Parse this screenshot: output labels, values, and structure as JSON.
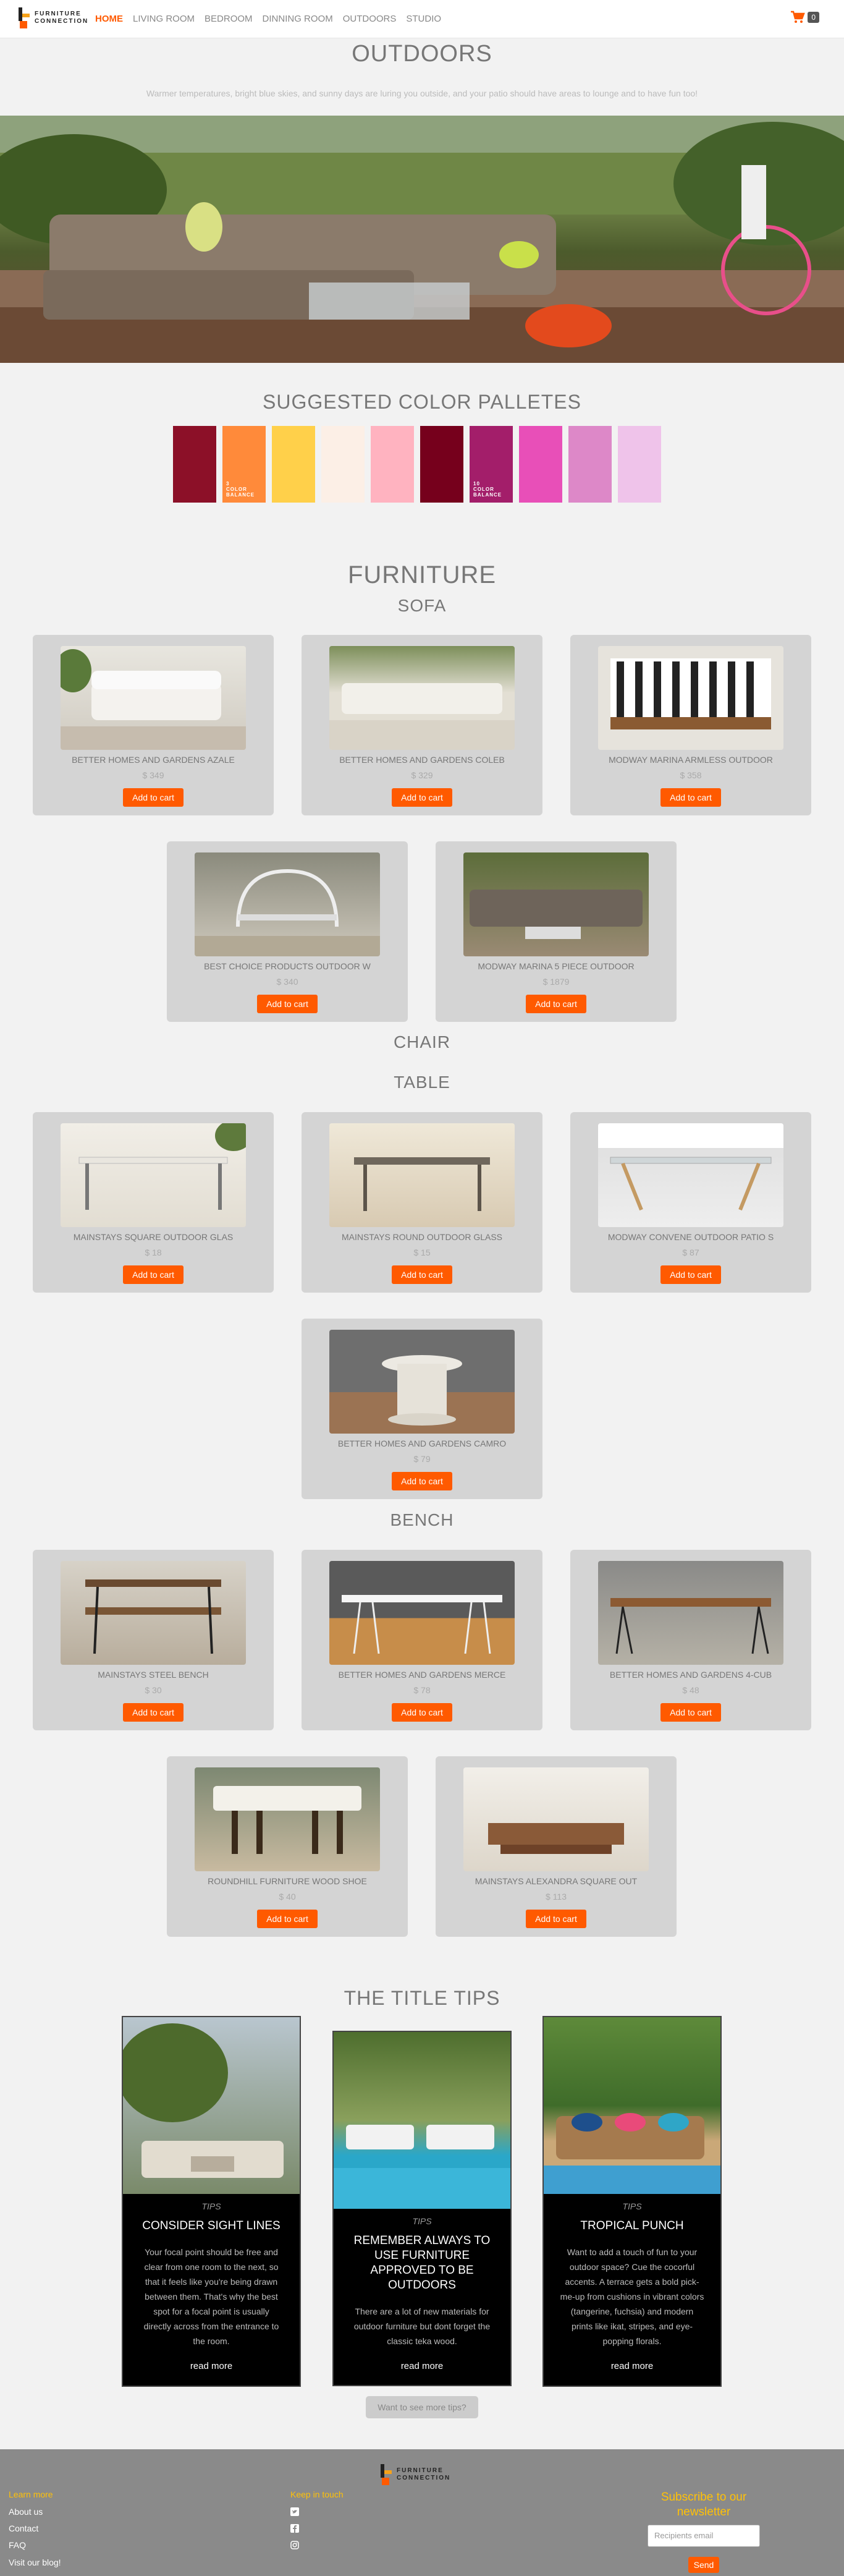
{
  "nav": {
    "logo_line1": "FURNITURE",
    "logo_line2": "CONNECTION",
    "links": [
      "HOME",
      "LIVING ROOM",
      "BEDROOM",
      "DINNING ROOM",
      "OUTDOORS",
      "STUDIO"
    ],
    "active": "HOME",
    "cart_count": "0",
    "cart_icon": "shopping-cart-icon"
  },
  "header": {
    "title": "OUTDOORS",
    "subtitle": "Warmer temperatures, bright blue skies, and sunny days are luring you outside, and your patio should have areas to lounge and to have fun too!"
  },
  "palettes": {
    "title": "SUGGESTED COLOR PALLETES",
    "swatches": [
      {
        "color": "#8c1028",
        "label": ""
      },
      {
        "color": "#ff8a3a",
        "label": ""
      },
      {
        "color": "#ffd04a",
        "label": ""
      },
      {
        "color": "#fcefe6",
        "label": ""
      },
      {
        "color": "#ffb3c0",
        "label": ""
      },
      {
        "color": "#76001c",
        "label": ""
      },
      {
        "color": "#a31e6a",
        "label": ""
      },
      {
        "color": "#e84fb8",
        "label": ""
      },
      {
        "color": "#dd88c8",
        "label": ""
      },
      {
        "color": "#efc3ea",
        "label": ""
      }
    ],
    "swatch_caption_a": "3\nCOLOR\nBALANCE",
    "swatch_caption_b": "10\nCOLOR\nBALANCE"
  },
  "furniture": {
    "title": "FURNITURE",
    "sofa_title": "SOFA",
    "chair_title": "CHAIR",
    "table_title": "TABLE",
    "bench_title": "BENCH",
    "add_to_cart": "Add to cart",
    "sofa": [
      {
        "name": "BETTER HOMES AND GARDENS AZALE",
        "price": "$ 349"
      },
      {
        "name": "BETTER HOMES AND GARDENS COLEB",
        "price": "$ 329"
      },
      {
        "name": "MODWAY MARINA ARMLESS OUTDOOR",
        "price": "$ 358"
      },
      {
        "name": "BEST CHOICE PRODUCTS OUTDOOR W",
        "price": "$ 340"
      },
      {
        "name": "MODWAY MARINA 5 PIECE OUTDOOR",
        "price": "$ 1879"
      }
    ],
    "table": [
      {
        "name": "MAINSTAYS SQUARE OUTDOOR GLAS",
        "price": "$ 18"
      },
      {
        "name": "MAINSTAYS ROUND OUTDOOR GLASS",
        "price": "$ 15"
      },
      {
        "name": "MODWAY CONVENE OUTDOOR PATIO S",
        "price": "$ 87"
      },
      {
        "name": "BETTER HOMES AND GARDENS CAMRO",
        "price": "$ 79"
      }
    ],
    "bench": [
      {
        "name": "MAINSTAYS STEEL BENCH",
        "price": "$ 30"
      },
      {
        "name": "BETTER HOMES AND GARDENS MERCE",
        "price": "$ 78"
      },
      {
        "name": "BETTER HOMES AND GARDENS 4-CUB",
        "price": "$ 48"
      },
      {
        "name": "ROUNDHILL FURNITURE WOOD SHOE",
        "price": "$ 40"
      },
      {
        "name": "MAINSTAYS ALEXANDRA SQUARE OUT",
        "price": "$ 113"
      }
    ]
  },
  "tips": {
    "title": "THE TITLE TIPS",
    "tag": "TIPS",
    "read_more": "read more",
    "items": [
      {
        "title": "CONSIDER SIGHT LINES",
        "text": "Your focal point should be free and clear from one room to the next, so that it feels like you're being drawn between them. That's why the best spot for a focal point is usually directly across from the entrance to the room."
      },
      {
        "title": "REMEMBER ALWAYS TO USE FURNITURE APPROVED TO BE OUTDOORS",
        "text": "There are a lot of new materials for outdoor furniture but dont forget the classic teka wood."
      },
      {
        "title": "TROPICAL PUNCH",
        "text": "Want to add a touch of fun to your outdoor space? Cue the cocorful accents. A terrace gets a bold pick-me-up from cushions in vibrant colors (tangerine, fuchsia) and modern prints like ikat, stripes, and eye-popping florals."
      }
    ],
    "more_button": "Want to see more tips?"
  },
  "footer": {
    "learn_more": "Learn more",
    "links": [
      "About us",
      "Contact",
      "FAQ",
      "Visit our blog!"
    ],
    "keep_in_touch": "Keep in touch",
    "social_icons": [
      "twitter-icon",
      "facebook-icon",
      "instagram-icon"
    ],
    "subscribe": "Subscribe to our newsletter",
    "email_placeholder": "Recipients email",
    "send": "Send"
  },
  "colors": {
    "accent": "#ff5a00",
    "footer_heading": "#ffc107"
  }
}
